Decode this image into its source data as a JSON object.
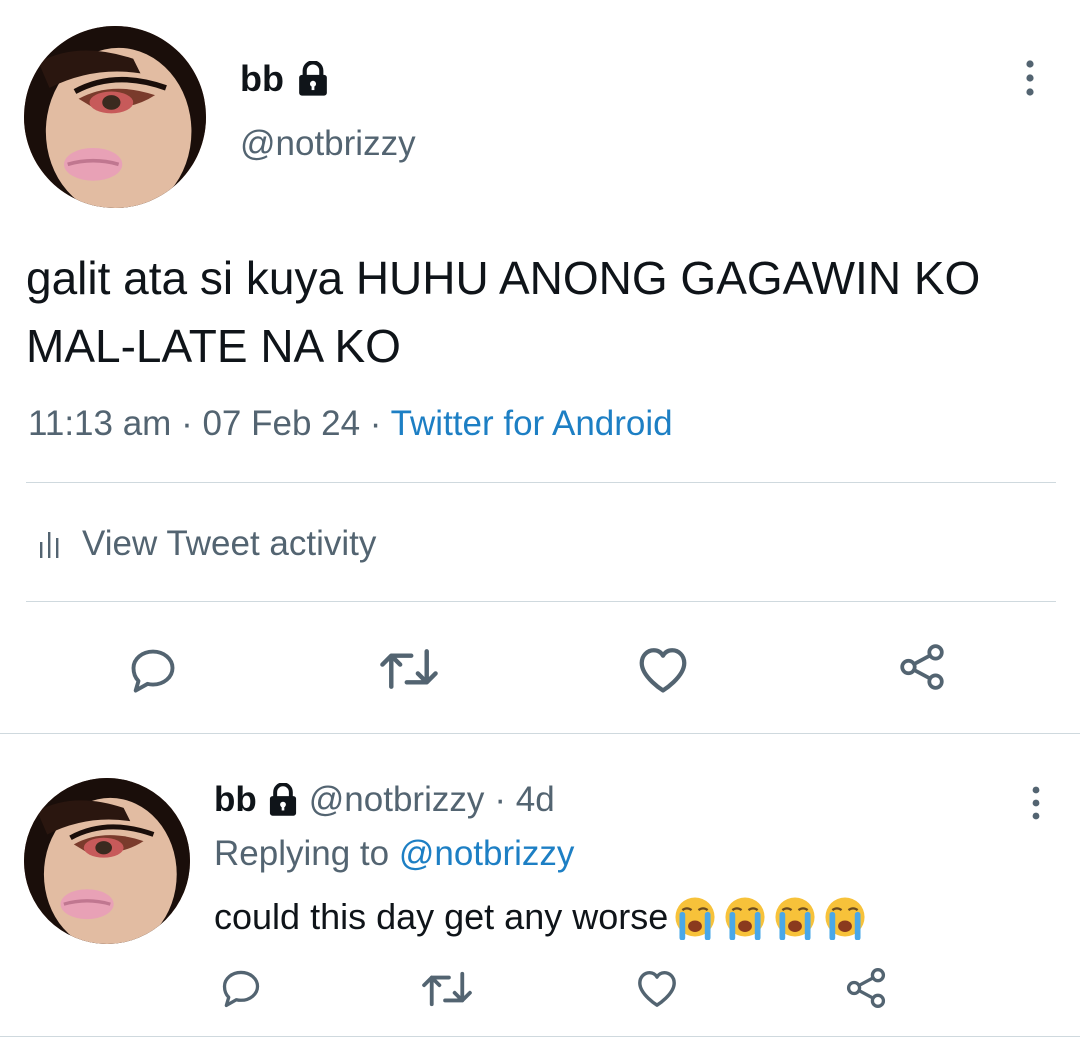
{
  "tweet": {
    "display_name": "bb",
    "handle": "@notbrizzy",
    "text": "galit ata si kuya HUHU ANONG GAGAWIN KO MAL-LATE NA KO",
    "time": "11:13 am",
    "date": "07 Feb 24",
    "separator": " · ",
    "source": "Twitter for Android",
    "activity_label": "View Tweet activity"
  },
  "reply": {
    "display_name": "bb",
    "handle": "@notbrizzy",
    "age": "· 4d",
    "replying_prefix": "Replying to",
    "replying_to": "@notbrizzy",
    "text": "could this day get any worse",
    "emoji": [
      "loudly-crying-face",
      "loudly-crying-face",
      "loudly-crying-face",
      "loudly-crying-face"
    ]
  },
  "icons": {
    "lock": "lock-icon",
    "more": "more-vertical-icon",
    "reply": "reply-icon",
    "retweet": "retweet-icon",
    "like": "heart-icon",
    "share": "share-icon",
    "activity": "bar-chart-icon"
  },
  "colors": {
    "text_primary": "#0f1419",
    "text_secondary": "#536471",
    "link": "#1d7fc4",
    "divider": "#cfd9de"
  }
}
